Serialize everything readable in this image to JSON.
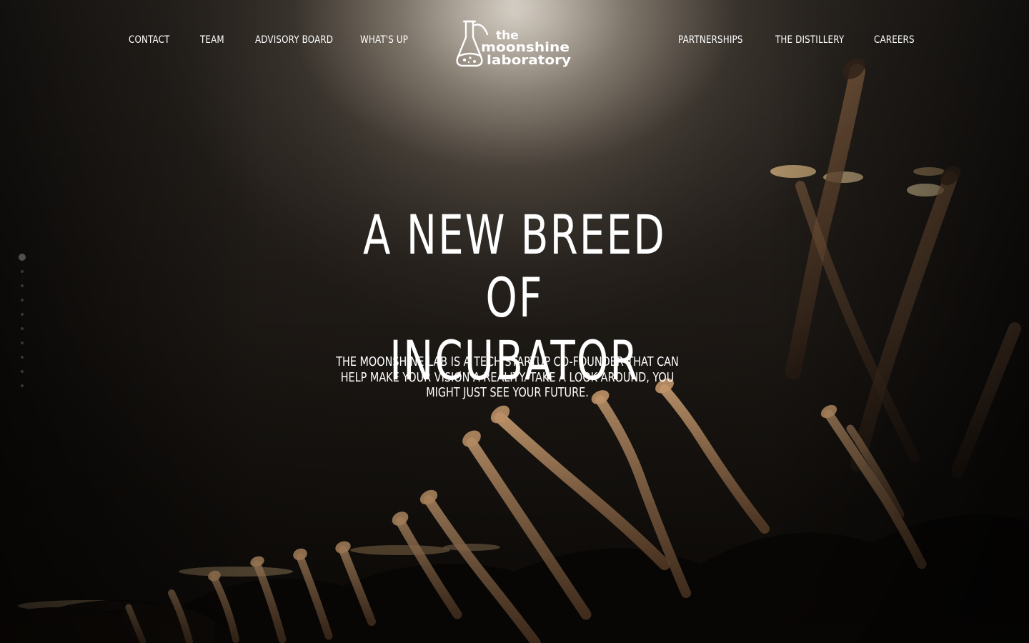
{
  "nav": {
    "left": [
      {
        "label": "CONTACT"
      },
      {
        "label": "TEAM"
      },
      {
        "label": "ADVISORY BOARD"
      },
      {
        "label": "WHAT'S UP"
      }
    ],
    "right": [
      {
        "label": "PARTNERSHIPS"
      },
      {
        "label": "THE DISTILLERY"
      },
      {
        "label": "CAREERS"
      }
    ]
  },
  "logo": {
    "line1": "the",
    "line2": "moonshine",
    "line3": "laboratory",
    "icon": "flask-icon"
  },
  "hero": {
    "headline_line1": "A NEW BREED OF",
    "headline_line2": "INCUBATOR",
    "subtext": "THE MOONSHINE LAB IS A TECH STARTUP CO-FOUNDER THAT CAN HELP MAKE YOUR VISION A REALITY. TAKE A LOOK AROUND, YOU MIGHT JUST SEE YOUR FUTURE."
  },
  "slide_dots": {
    "count": 10,
    "active_index": 0
  },
  "colors": {
    "text": "#ffffff",
    "background": "#0d0b09",
    "spotlight": "#e6ded2",
    "skin_tone": "#c89a6e"
  }
}
